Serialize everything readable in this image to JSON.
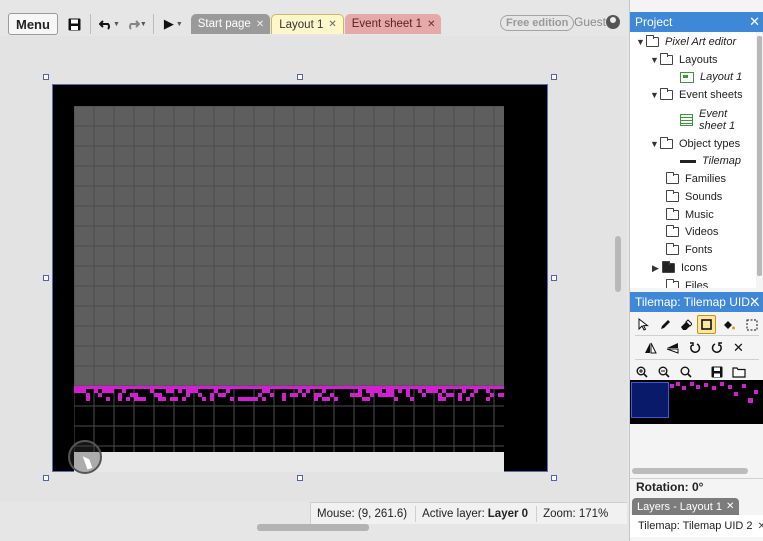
{
  "toolbar": {
    "menu_label": "Menu",
    "tabs": [
      {
        "label": "Start page"
      },
      {
        "label": "Layout 1"
      },
      {
        "label": "Event sheet 1"
      }
    ],
    "edition_badge": "Free edition",
    "user_label": "Guest"
  },
  "icons": {
    "save": "save-icon",
    "undo": "undo-icon",
    "redo": "redo-icon",
    "play": "play-icon",
    "close": "close-icon"
  },
  "status": {
    "mouse": "Mouse: (9, 261.6)",
    "active_layer_label": "Active layer:",
    "active_layer_value": "Layer 0",
    "zoom": "Zoom: 171%"
  },
  "project_panel": {
    "title": "Project",
    "items": [
      {
        "label": "Pixel Art editor"
      },
      {
        "label": "Layouts"
      },
      {
        "label": "Layout 1"
      },
      {
        "label": "Event sheets"
      },
      {
        "label": "Event sheet 1"
      },
      {
        "label": "Object types"
      },
      {
        "label": "Tilemap"
      },
      {
        "label": "Families"
      },
      {
        "label": "Sounds"
      },
      {
        "label": "Music"
      },
      {
        "label": "Videos"
      },
      {
        "label": "Fonts"
      },
      {
        "label": "Icons"
      },
      {
        "label": "Files"
      }
    ]
  },
  "tilemap_panel": {
    "title": "Tilemap: Tilemap UID...",
    "rotation": "Rotation: 0°"
  },
  "bottom": {
    "tab_label": "Layers - Layout 1",
    "properties_label": "Tilemap: Tilemap UID 2"
  },
  "colors": {
    "accent": "#3f88d8",
    "tile_magenta": "#d11fd1",
    "grid_gray": "#5e5e5e"
  }
}
